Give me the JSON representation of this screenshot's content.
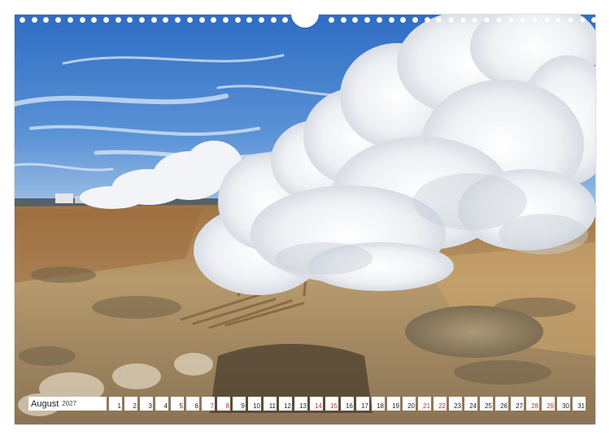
{
  "calendar": {
    "month": "August",
    "year": "2027",
    "days": [
      {
        "n": "1",
        "red": false
      },
      {
        "n": "2",
        "red": false
      },
      {
        "n": "3",
        "red": false
      },
      {
        "n": "4",
        "red": false
      },
      {
        "n": "5",
        "red": false
      },
      {
        "n": "6",
        "red": false
      },
      {
        "n": "7",
        "red": true
      },
      {
        "n": "8",
        "red": true
      },
      {
        "n": "9",
        "red": false
      },
      {
        "n": "10",
        "red": false
      },
      {
        "n": "11",
        "red": false
      },
      {
        "n": "12",
        "red": false
      },
      {
        "n": "13",
        "red": false
      },
      {
        "n": "14",
        "red": true
      },
      {
        "n": "15",
        "red": true
      },
      {
        "n": "16",
        "red": false
      },
      {
        "n": "17",
        "red": false
      },
      {
        "n": "18",
        "red": false
      },
      {
        "n": "19",
        "red": false
      },
      {
        "n": "20",
        "red": false
      },
      {
        "n": "21",
        "red": true
      },
      {
        "n": "22",
        "red": true
      },
      {
        "n": "23",
        "red": false
      },
      {
        "n": "24",
        "red": false
      },
      {
        "n": "25",
        "red": false
      },
      {
        "n": "26",
        "red": false
      },
      {
        "n": "27",
        "red": false
      },
      {
        "n": "28",
        "red": true
      },
      {
        "n": "29",
        "red": true
      },
      {
        "n": "30",
        "red": false
      },
      {
        "n": "31",
        "red": false
      }
    ]
  },
  "colors": {
    "sky": "#4a86cf",
    "steam": "#f3f4f6",
    "ground": "#b8965e",
    "weekend": "#c0392b"
  }
}
